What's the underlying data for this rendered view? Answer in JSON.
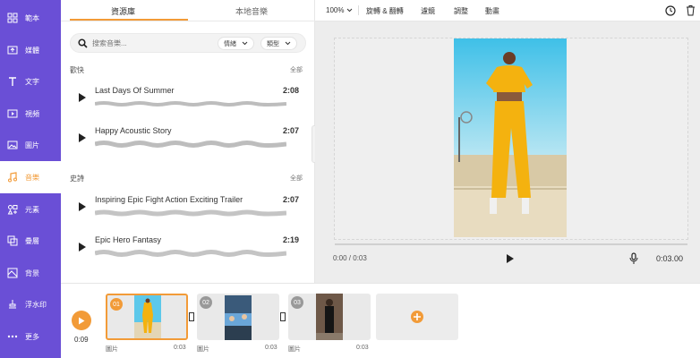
{
  "sidebar": {
    "items": [
      {
        "label": "範本",
        "icon": "template-icon"
      },
      {
        "label": "媒體",
        "icon": "media-upload-icon"
      },
      {
        "label": "文字",
        "icon": "text-icon"
      },
      {
        "label": "視頻",
        "icon": "video-icon"
      },
      {
        "label": "圖片",
        "icon": "image-icon"
      },
      {
        "label": "音樂",
        "icon": "music-icon"
      },
      {
        "label": "元素",
        "icon": "elements-icon"
      },
      {
        "label": "疊層",
        "icon": "overlay-icon"
      },
      {
        "label": "背景",
        "icon": "background-icon"
      },
      {
        "label": "浮水印",
        "icon": "watermark-icon"
      },
      {
        "label": "更多",
        "icon": "more-icon"
      }
    ],
    "active_index": 5
  },
  "panel": {
    "tabs": [
      "資源庫",
      "本地音樂"
    ],
    "search_placeholder": "搜索音樂...",
    "filter_mood": "情緒",
    "filter_genre": "類型",
    "sections": [
      {
        "title": "歡快",
        "all_label": "全部",
        "tracks": [
          {
            "name": "Last Days Of Summer",
            "duration": "2:08"
          },
          {
            "name": "Happy Acoustic Story",
            "duration": "2:07"
          }
        ]
      },
      {
        "title": "史詩",
        "all_label": "全部",
        "tracks": [
          {
            "name": "Inspiring Epic Fight Action Exciting Trailer",
            "duration": "2:07"
          },
          {
            "name": "Epic Hero Fantasy",
            "duration": "2:19"
          }
        ]
      }
    ]
  },
  "toolbar": {
    "zoom": "100%",
    "rotate_crop": "旋轉 & 翻轉",
    "filter": "濾鏡",
    "adjust": "調整",
    "animation": "動畫"
  },
  "player": {
    "current": "0:00 / 0:03",
    "total": "0:03.00",
    "progress": 0
  },
  "timeline": {
    "total_time": "0:09",
    "clips": [
      {
        "num": "01",
        "label": "圖片",
        "duration": "0:03",
        "selected": true
      },
      {
        "num": "02",
        "label": "圖片",
        "duration": "0:03",
        "selected": false
      },
      {
        "num": "03",
        "label": "圖片",
        "duration": "0:03",
        "selected": false
      }
    ]
  },
  "colors": {
    "sidebar": "#6a4fd6",
    "accent": "#f29b38"
  }
}
